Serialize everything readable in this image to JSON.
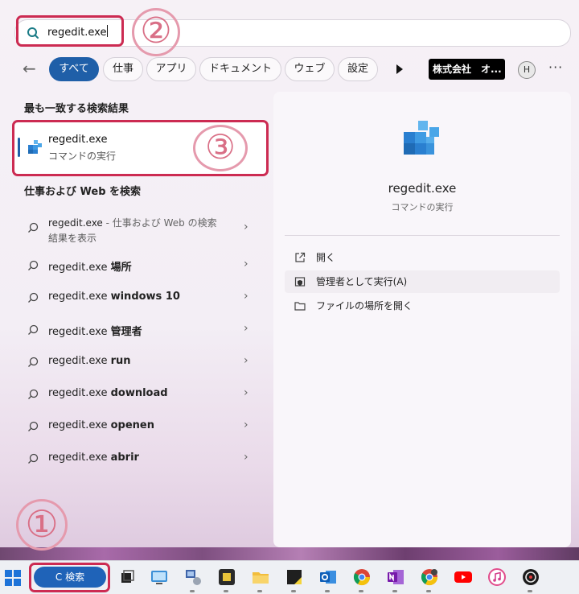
{
  "search": {
    "value": "regedit.exe"
  },
  "annotations": {
    "one": "①",
    "two": "②",
    "three": "③"
  },
  "filters": {
    "back": "←",
    "chips": [
      "すべて",
      "仕事",
      "アプリ",
      "ドキュメント",
      "ウェブ",
      "設定"
    ],
    "org": "株式会社　オ...",
    "avatar": "H",
    "more": "···"
  },
  "best_match": {
    "title": "最も一致する検索結果",
    "name": "regedit.exe",
    "subtitle": "コマンドの実行"
  },
  "web": {
    "title": "仕事および Web を検索",
    "first": {
      "bold": "regedit.exe",
      "rest": " - 仕事および Web の検索",
      "sub": "結果を表示"
    },
    "items": [
      {
        "base": "regedit.exe ",
        "bold": "場所"
      },
      {
        "base": "regedit.exe ",
        "bold": "windows 10"
      },
      {
        "base": "regedit.exe ",
        "bold": "管理者"
      },
      {
        "base": "regedit.exe ",
        "bold": "run"
      },
      {
        "base": "regedit.exe ",
        "bold": "download"
      },
      {
        "base": "regedit.exe ",
        "bold": "openen"
      },
      {
        "base": "regedit.exe ",
        "bold": "abrir"
      }
    ],
    "chevron": "›"
  },
  "detail": {
    "name": "regedit.exe",
    "subtitle": "コマンドの実行",
    "actions": [
      "開く",
      "管理者として実行(A)",
      "ファイルの場所を開く"
    ]
  },
  "taskbar": {
    "search_label": "C 検索",
    "icons": [
      "task-view-icon",
      "remote-desktop-icon",
      "network-icon",
      "chip-app-icon",
      "file-explorer-icon",
      "sticky-notes-icon",
      "outlook-icon",
      "chrome-icon",
      "onenote-icon",
      "chrome-profile-icon",
      "youtube-icon",
      "itunes-icon",
      "obs-icon"
    ]
  },
  "colors": {
    "accent": "#1f5fa8",
    "annotation_red": "#cc2b52",
    "annotation_pink": "#d96f86"
  }
}
